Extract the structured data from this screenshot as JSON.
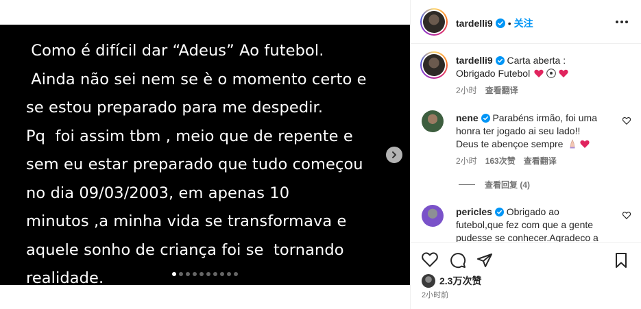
{
  "post": {
    "slides": {
      "lines": [
        " Como é difícil dar “Adeus” Ao futebol.",
        " Ainda não sei nem se è o momento certo e",
        "se estou preparado para me despedir.",
        "Pq  foi assim tbm , meio que de repente e",
        "sem eu estar preparado que tudo começou",
        "no dia 09/03/2003, em apenas 10",
        "minutos ,a minha vida se transformava e",
        "aquele sonho de criança foi se  tornando",
        "realidade."
      ],
      "dot_count": 10,
      "active_dot": 0
    }
  },
  "header": {
    "username": "tardelli9",
    "separator": "•",
    "follow_label": "关注"
  },
  "caption": {
    "username": "tardelli9",
    "text_line1": "Carta aberta :",
    "text_line2": "Obrigado Futebol",
    "emojis": [
      "red-heart",
      "soccer-ball",
      "red-heart"
    ],
    "time": "2小时",
    "translate_label": "查看翻译"
  },
  "comments": [
    {
      "username": "nene",
      "text_line1": "Parabéns irmão, foi uma",
      "text_line2": "honra ter jogado ai seu lado!!",
      "text_line3": "Deus te abençoe sempre",
      "emojis": [
        "praying-hands",
        "red-heart"
      ],
      "time": "2小时",
      "likes": "163次赞",
      "translate_label": "查看翻译",
      "replies_label": "查看回复 (4)"
    },
    {
      "username": "pericles",
      "text_line1": "Obrigado ao",
      "text_line2": "futebol,que fez com que a gente",
      "text_line3": "pudesse se conhecer.Agradeco a"
    }
  ],
  "actions": {
    "icons": [
      "heart-icon",
      "comment-icon",
      "share-icon",
      "bookmark-icon"
    ],
    "likes": "2.3万次赞",
    "time": "2小时前"
  },
  "colors": {
    "accent": "#0095f6",
    "verified": "#0095f6",
    "heart": "#ff3040"
  }
}
